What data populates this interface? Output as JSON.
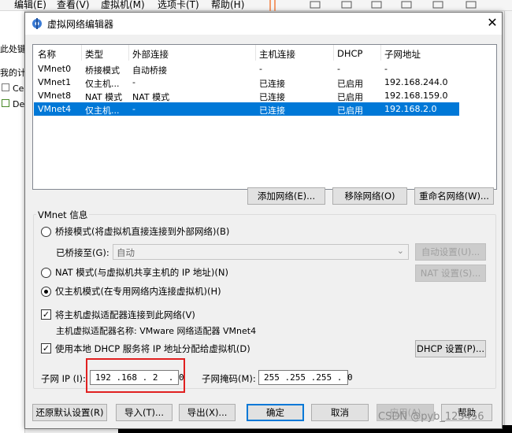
{
  "background": {
    "menu": [
      "编辑(E)",
      "查看(V)",
      "虚拟机(M)",
      "选项卡(T)",
      "帮助(H)"
    ],
    "left_items": [
      "此处键",
      "我的计",
      "Ce",
      "De"
    ]
  },
  "dialog": {
    "title": "虚拟网络编辑器",
    "columns": [
      "名称",
      "类型",
      "外部连接",
      "主机连接",
      "DHCP",
      "子网地址"
    ],
    "rows": [
      {
        "name": "VMnet0",
        "type": "桥接模式",
        "external": "自动桥接",
        "host": "-",
        "dhcp": "-",
        "subnet": "-"
      },
      {
        "name": "VMnet1",
        "type": "仅主机...",
        "external": "-",
        "host": "已连接",
        "dhcp": "已启用",
        "subnet": "192.168.244.0"
      },
      {
        "name": "VMnet8",
        "type": "NAT 模式",
        "external": "NAT 模式",
        "host": "已连接",
        "dhcp": "已启用",
        "subnet": "192.168.159.0"
      },
      {
        "name": "VMnet4",
        "type": "仅主机...",
        "external": "-",
        "host": "已连接",
        "dhcp": "已启用",
        "subnet": "192.168.2.0"
      }
    ],
    "selected_row": 3,
    "net_buttons": {
      "add": "添加网络(E)...",
      "remove": "移除网络(O)",
      "rename": "重命名网络(W)..."
    },
    "group_title": "VMnet 信息",
    "bridge_mode": "桥接模式(将虚拟机直接连接到外部网络)(B)",
    "bridged_to_label": "已桥接至(G):",
    "bridged_to_value": "自动",
    "auto_settings": "自动设置(U)...",
    "nat_mode": "NAT 模式(与虚拟机共享主机的 IP 地址)(N)",
    "nat_settings": "NAT 设置(S)...",
    "host_only_mode": "仅主机模式(在专用网络内连接虚拟机)(H)",
    "connect_adapter": "将主机虚拟适配器连接到此网络(V)",
    "adapter_name": "主机虚拟适配器名称: VMware 网络适配器 VMnet4",
    "use_dhcp": "使用本地 DHCP 服务将 IP 地址分配给虚拟机(D)",
    "dhcp_settings": "DHCP 设置(P)...",
    "subnet_ip_label": "子网 IP (I):",
    "subnet_ip": "192 .168 . 2  . 0",
    "subnet_mask_label": "子网掩码(M):",
    "subnet_mask": "255 .255 .255 . 0",
    "footer": {
      "restore": "还原默认设置(R)",
      "import": "导入(T)...",
      "export": "导出(X)...",
      "ok": "确定",
      "cancel": "取消",
      "apply": "应用(A)",
      "help": "帮助"
    }
  },
  "watermark": "CSDN @pyb_123456",
  "colors": {
    "selection": "#0078d7",
    "highlight_box": "#e02020"
  }
}
